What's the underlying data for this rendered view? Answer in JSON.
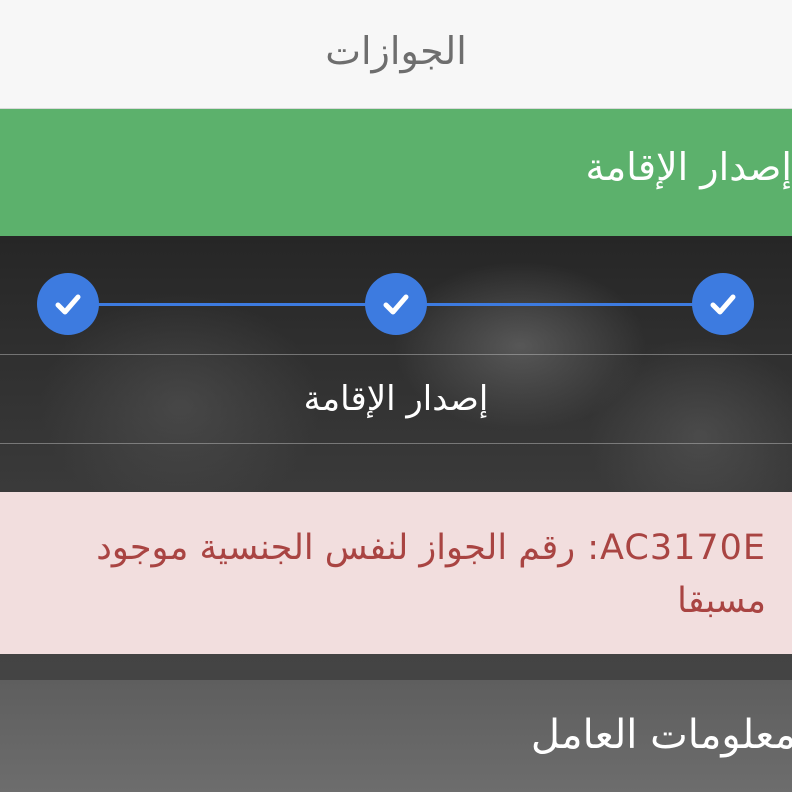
{
  "header": {
    "title": "الجوازات"
  },
  "section": {
    "title": "إصدار الإقامة"
  },
  "stepper": {
    "steps": [
      {
        "icon": "check-icon",
        "completed": true
      },
      {
        "icon": "check-icon",
        "completed": true
      },
      {
        "icon": "check-icon",
        "completed": true
      }
    ],
    "current_label": "إصدار الإقامة"
  },
  "alert": {
    "message": "AC3170E: رقم الجواز لنفس الجنسية موجود مسبقا"
  },
  "worker_info": {
    "title": "معلومات العامل"
  },
  "colors": {
    "header_bg": "#f7f7f7",
    "section_bg": "#5cb16c",
    "step_blue": "#3d7be0",
    "alert_bg": "#f2dede",
    "alert_text": "#a94442"
  }
}
